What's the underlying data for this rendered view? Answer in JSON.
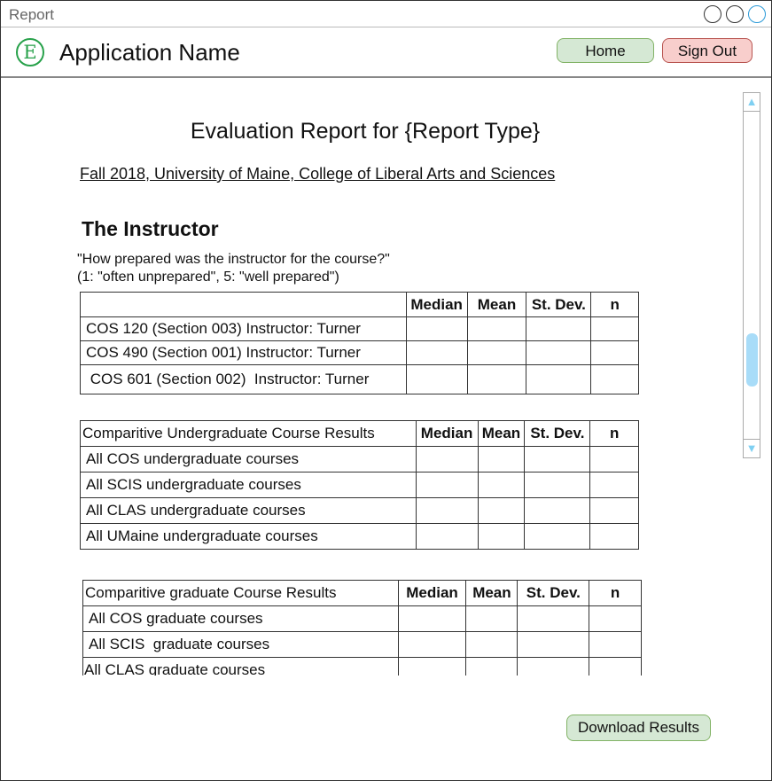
{
  "window": {
    "title": "Report"
  },
  "header": {
    "logo_letter": "E",
    "app_name": "Application Name",
    "home_label": "Home",
    "signout_label": "Sign Out"
  },
  "report": {
    "title": "Evaluation Report for {Report Type}",
    "context": "Fall 2018, University of Maine, College of Liberal Arts and Sciences",
    "section": "The Instructor",
    "question_line1": "\"How prepared was the instructor for the course?\"",
    "question_line2": "(1: \"often unprepared\", 5: \"well prepared\")"
  },
  "columns": [
    "Median",
    "Mean",
    "St. Dev.",
    "n"
  ],
  "instructor_table": {
    "header": "",
    "rows": [
      "COS 120 (Section 003)  Instructor: Turner",
      "COS 490 (Section 001)  Instructor: Turner",
      " COS 601 (Section 002)  Instructor: Turner"
    ]
  },
  "undergrad_table": {
    "header": "Comparitive Undergraduate Course Results",
    "rows": [
      "All COS undergraduate courses",
      "All SCIS undergraduate courses",
      "All CLAS undergraduate courses",
      "All UMaine undergraduate courses"
    ]
  },
  "grad_table": {
    "header": "Comparitive graduate Course Results",
    "rows": [
      "All COS graduate courses",
      "All SCIS  graduate courses",
      "All CLAS graduate courses"
    ]
  },
  "download_label": "Download Results",
  "colors": {
    "green_button": "#d5e8d4",
    "red_button": "#f8cecc",
    "accent": "#27a14a",
    "scroll": "#a8dcf8"
  }
}
